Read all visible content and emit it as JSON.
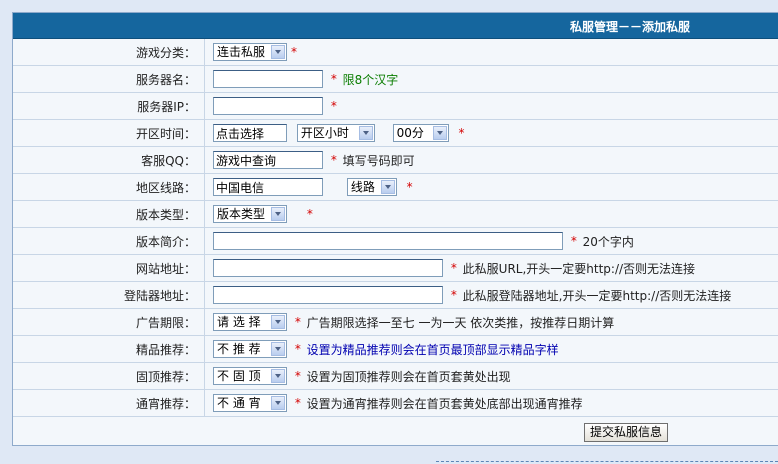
{
  "title": "私服管理－－添加私服",
  "fields": {
    "game_category": {
      "label": "游戏分类：",
      "value": "连击私服"
    },
    "server_name": {
      "label": "服务器名：",
      "value": "",
      "hint": "限8个汉字"
    },
    "server_ip": {
      "label": "服务器IP：",
      "value": ""
    },
    "open_time": {
      "label": "开区时间：",
      "value": "点击选择",
      "hour": "开区小时",
      "minute": "00分"
    },
    "service_qq": {
      "label": "客服QQ：",
      "value": "游戏中查询",
      "hint": "填写号码即可"
    },
    "region_line": {
      "label": "地区线路：",
      "value": "中国电信",
      "line": "线路"
    },
    "version_type": {
      "label": "版本类型：",
      "value": "版本类型"
    },
    "version_intro": {
      "label": "版本简介：",
      "value": "",
      "hint": "20个字内"
    },
    "website": {
      "label": "网站地址：",
      "value": "",
      "hint": "此私服URL,开头一定要http://否则无法连接"
    },
    "login_server": {
      "label": "登陆器地址：",
      "value": "",
      "hint": "此私服登陆器地址,开头一定要http://否则无法连接"
    },
    "ad_period": {
      "label": "广告期限：",
      "value": "请 选 择",
      "hint": "广告期限选择一至七 一为一天 依次类推，按推荐日期计算"
    },
    "featured": {
      "label": "精品推荐：",
      "value": "不 推 荐",
      "hint": "设置为精品推荐则会在首页最顶部显示精品字样"
    },
    "pinned": {
      "label": "固顶推荐：",
      "value": "不 固 顶",
      "hint": "设置为固顶推荐则会在首页套黄处出现"
    },
    "overnight": {
      "label": "通宵推荐：",
      "value": "不 通 宵",
      "hint": "设置为通宵推荐则会在首页套黄处底部出现通宵推荐"
    }
  },
  "required_mark": "*",
  "submit_label": "提交私服信息"
}
